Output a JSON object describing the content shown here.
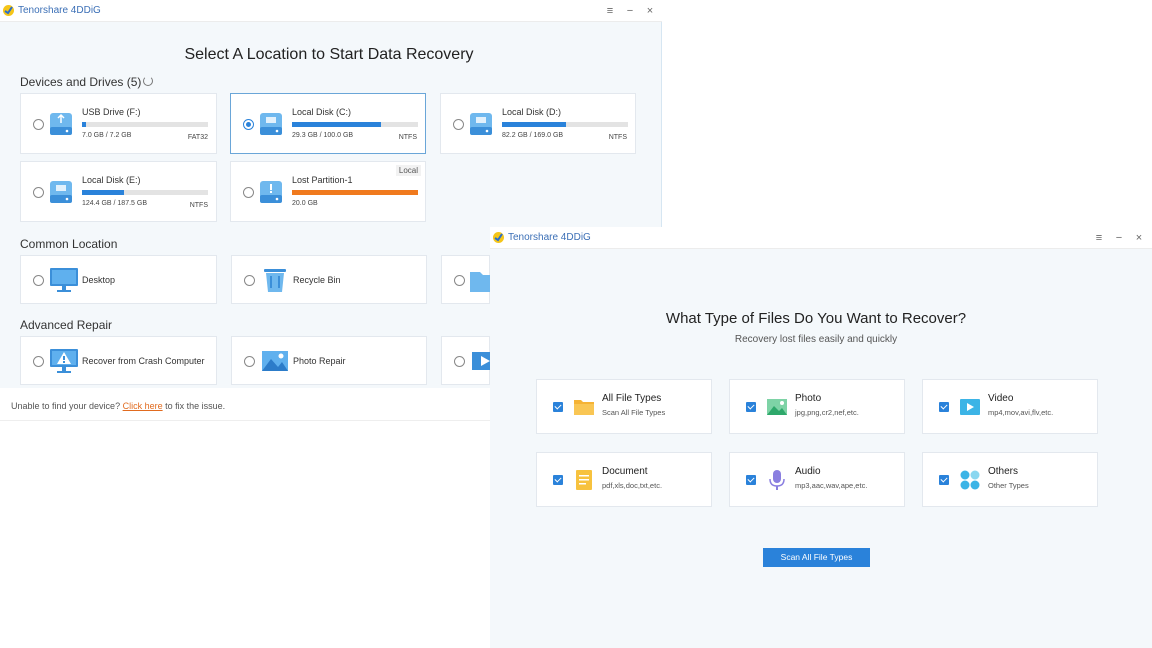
{
  "window1": {
    "app_title": "Tenorshare 4DDiG",
    "heading": "Select A Location to Start Data Recovery",
    "devices_section": "Devices and Drives (5)",
    "drives": [
      {
        "name": "USB Drive (F:)",
        "size": "7.0 GB / 7.2 GB",
        "fs": "FAT32",
        "usage": 0.03,
        "selected": false
      },
      {
        "name": "Local Disk (C:)",
        "size": "29.3 GB / 100.0 GB",
        "fs": "NTFS",
        "usage": 0.71,
        "selected": true
      },
      {
        "name": "Local Disk (D:)",
        "size": "82.2 GB / 169.0 GB",
        "fs": "NTFS",
        "usage": 0.51,
        "selected": false
      },
      {
        "name": "Local Disk (E:)",
        "size": "124.4 GB / 187.5 GB",
        "fs": "NTFS",
        "usage": 0.33,
        "selected": false
      },
      {
        "name": "Lost Partition-1",
        "size": "20.0 GB",
        "fs": "",
        "badge": "Local",
        "usage": 1.0,
        "selected": false
      }
    ],
    "common_section": "Common Location",
    "common": [
      {
        "label": "Desktop",
        "icon": "desktop-icon"
      },
      {
        "label": "Recycle Bin",
        "icon": "recycle-bin-icon"
      }
    ],
    "advanced_section": "Advanced Repair",
    "advanced": [
      {
        "label": "Recover from Crash Computer",
        "icon": "crash-computer-icon"
      },
      {
        "label": "Photo Repair",
        "icon": "photo-repair-icon"
      }
    ],
    "footer_prefix": "Unable to find your device?",
    "footer_link": "Click here",
    "footer_suffix": "to fix the issue."
  },
  "window2": {
    "app_title": "Tenorshare 4DDiG",
    "heading": "What Type of Files Do You Want to Recover?",
    "subheading": "Recovery lost files easily and quickly",
    "file_types": [
      {
        "name": "All File Types",
        "desc": "Scan All File Types",
        "icon": "folder-icon"
      },
      {
        "name": "Photo",
        "desc": "jpg,png,cr2,nef,etc.",
        "icon": "photo-icon"
      },
      {
        "name": "Video",
        "desc": "mp4,mov,avi,flv,etc.",
        "icon": "video-icon"
      },
      {
        "name": "Document",
        "desc": "pdf,xls,doc,txt,etc.",
        "icon": "document-icon"
      },
      {
        "name": "Audio",
        "desc": "mp3,aac,wav,ape,etc.",
        "icon": "microphone-icon"
      },
      {
        "name": "Others",
        "desc": "Other Types",
        "icon": "others-icon"
      }
    ],
    "scan_button": "Scan All File Types"
  },
  "window_controls": {
    "menu": "≡",
    "minimize": "−",
    "close": "×"
  },
  "colors": {
    "accent": "#2a82da",
    "lost_partition": "#f07a1e",
    "link": "#e16b1f"
  }
}
